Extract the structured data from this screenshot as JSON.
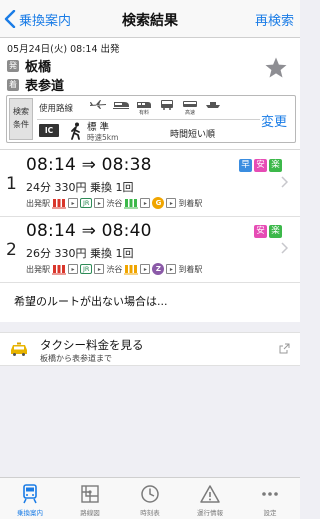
{
  "nav": {
    "back_label": "乗換案内",
    "title": "検索結果",
    "right_label": "再検索"
  },
  "search": {
    "datetime": "05月24日(火) 08:14 出発",
    "from_badge": "発",
    "from_station": "板橋",
    "to_badge": "着",
    "to_station": "表参道"
  },
  "conditions": {
    "label_line1": "検索",
    "label_line2": "条件",
    "use_lines_label": "使用路線",
    "mode_labels": [
      "有料",
      "高速"
    ],
    "ic_label": "IC",
    "walk_main": "標 準",
    "walk_sub": "時速5km",
    "sort_label": "時間短い順",
    "change_label": "変更"
  },
  "routes": [
    {
      "number": "1",
      "time": "08:14 ⇒ 08:38",
      "meta": "24分  330円 乗換 1回",
      "badges": [
        {
          "text": "早",
          "color": "#3a8de0"
        },
        {
          "text": "安",
          "color": "#e64cb5"
        },
        {
          "text": "楽",
          "color": "#3cb84a"
        }
      ],
      "dep_label": "出発駅",
      "jr_label": "JR",
      "transfer_station": "渋谷",
      "line_badge": "G",
      "line_color": "#f0a500",
      "arr_label": "到着駅"
    },
    {
      "number": "2",
      "time": "08:14 ⇒ 08:40",
      "meta": "26分  330円 乗換 1回",
      "badges": [
        {
          "text": "安",
          "color": "#e64cb5"
        },
        {
          "text": "楽",
          "color": "#3cb84a"
        }
      ],
      "dep_label": "出発駅",
      "jr_label": "JR",
      "transfer_station": "渋谷",
      "line_badge": "Z",
      "line_color": "#8b5aa8",
      "arr_label": "到着駅"
    }
  ],
  "no_route_text": "希望のルートが出ない場合は...",
  "taxi": {
    "title": "タクシー料金を見る",
    "subtitle": "板橋から表参道まで"
  },
  "tabs": [
    {
      "label": "乗換案内",
      "icon": "train-icon",
      "active": true
    },
    {
      "label": "路線図",
      "icon": "route-map-icon",
      "active": false
    },
    {
      "label": "時刻表",
      "icon": "clock-icon",
      "active": false
    },
    {
      "label": "運行情報",
      "icon": "warning-icon",
      "active": false
    },
    {
      "label": "設定",
      "icon": "more-icon",
      "active": false
    }
  ],
  "colors": {
    "accent": "#1a7ce6",
    "red_train": "#d9362b",
    "green_train": "#3cb84a",
    "yellow_train": "#f0a500"
  }
}
